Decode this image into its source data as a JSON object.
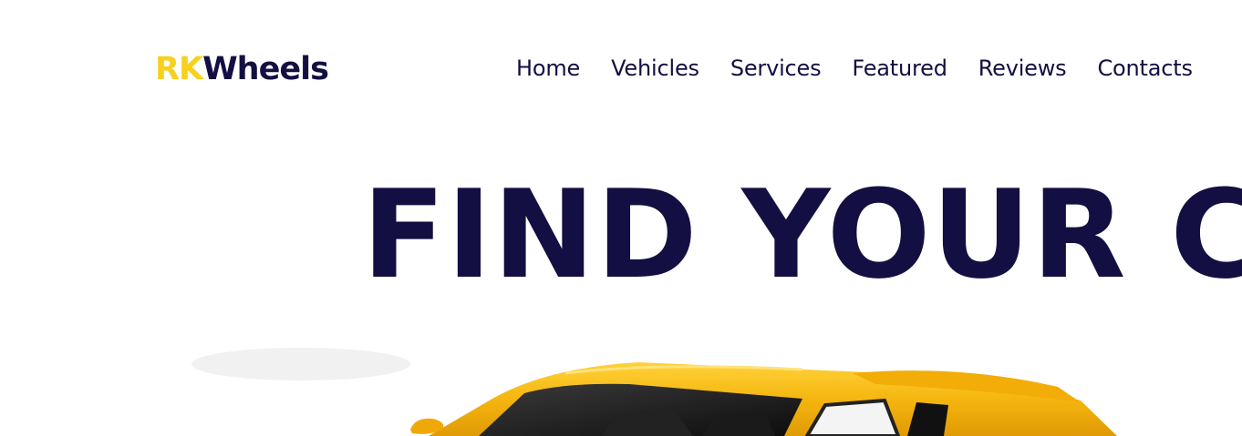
{
  "header": {
    "logo": {
      "accent": "RK",
      "main": "Wheels"
    },
    "nav": [
      {
        "label": "Home"
      },
      {
        "label": "Vehicles"
      },
      {
        "label": "Services"
      },
      {
        "label": "Featured"
      },
      {
        "label": "Reviews"
      },
      {
        "label": "Contacts"
      }
    ]
  },
  "hero": {
    "title": "FIND YOUR CAR",
    "image": "yellow-sports-car"
  },
  "colors": {
    "brand_accent": "#f7d11e",
    "brand_dark": "#140f42",
    "background": "#ffffff",
    "car_body": "#f5b60f"
  }
}
